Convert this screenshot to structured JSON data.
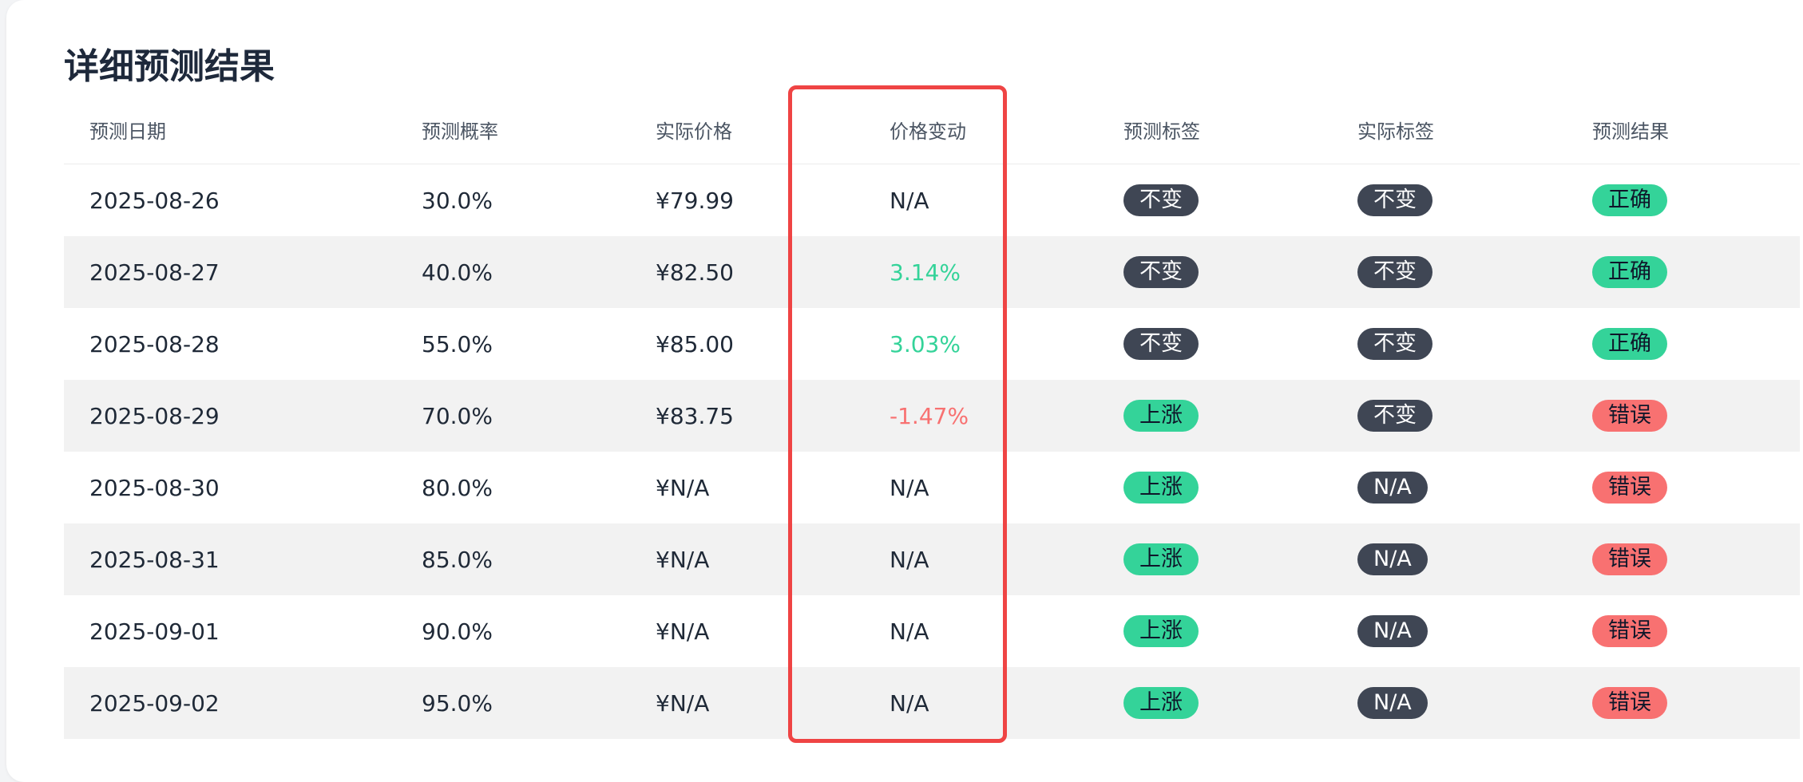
{
  "section_title": "详细预测结果",
  "columns": [
    "预测日期",
    "预测概率",
    "实际价格",
    "价格变动",
    "预测标签",
    "实际标签",
    "预测结果"
  ],
  "rows": [
    {
      "date": "2025-08-26",
      "probability": "30.0%",
      "price": "¥79.99",
      "change": "N/A",
      "change_dir": "none",
      "pred_label": "不变",
      "actual_label": "不变",
      "result": "正确"
    },
    {
      "date": "2025-08-27",
      "probability": "40.0%",
      "price": "¥82.50",
      "change": "3.14%",
      "change_dir": "up",
      "pred_label": "不变",
      "actual_label": "不变",
      "result": "正确"
    },
    {
      "date": "2025-08-28",
      "probability": "55.0%",
      "price": "¥85.00",
      "change": "3.03%",
      "change_dir": "up",
      "pred_label": "不变",
      "actual_label": "不变",
      "result": "正确"
    },
    {
      "date": "2025-08-29",
      "probability": "70.0%",
      "price": "¥83.75",
      "change": "-1.47%",
      "change_dir": "down",
      "pred_label": "上涨",
      "actual_label": "不变",
      "result": "错误"
    },
    {
      "date": "2025-08-30",
      "probability": "80.0%",
      "price": "¥N/A",
      "change": "N/A",
      "change_dir": "none",
      "pred_label": "上涨",
      "actual_label": "N/A",
      "result": "错误"
    },
    {
      "date": "2025-08-31",
      "probability": "85.0%",
      "price": "¥N/A",
      "change": "N/A",
      "change_dir": "none",
      "pred_label": "上涨",
      "actual_label": "N/A",
      "result": "错误"
    },
    {
      "date": "2025-09-01",
      "probability": "90.0%",
      "price": "¥N/A",
      "change": "N/A",
      "change_dir": "none",
      "pred_label": "上涨",
      "actual_label": "N/A",
      "result": "错误"
    },
    {
      "date": "2025-09-02",
      "probability": "95.0%",
      "price": "¥N/A",
      "change": "N/A",
      "change_dir": "none",
      "pred_label": "上涨",
      "actual_label": "N/A",
      "result": "错误"
    }
  ],
  "badge_colors": {
    "不变": "#3f4654",
    "N/A": "#3f4654",
    "上涨": "#34d399",
    "正确": "#34d399",
    "错误": "#f87171"
  },
  "change_colors": {
    "up": "#34d399",
    "down": "#f87171"
  },
  "highlight_color": "#ef4444"
}
